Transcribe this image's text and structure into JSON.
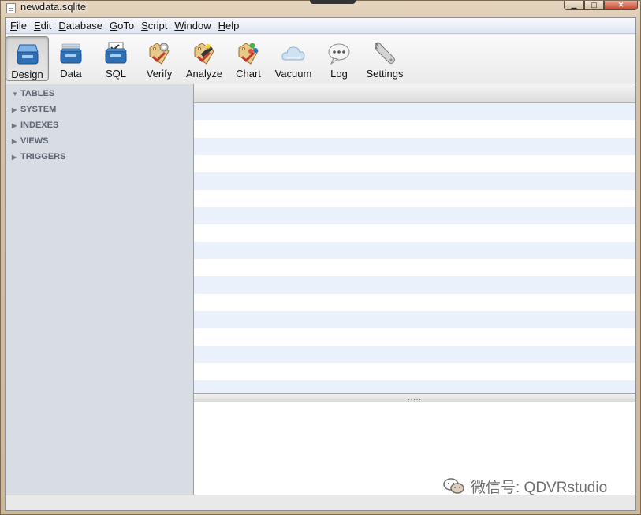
{
  "window": {
    "title": "newdata.sqlite"
  },
  "menu": [
    "File",
    "Edit",
    "Database",
    "GoTo",
    "Script",
    "Window",
    "Help"
  ],
  "toolbar": {
    "buttons": [
      {
        "label": "Design",
        "icon": "design-icon",
        "active": true
      },
      {
        "label": "Data",
        "icon": "data-icon"
      },
      {
        "label": "SQL",
        "icon": "sql-icon"
      },
      {
        "label": "Verify",
        "icon": "verify-icon"
      },
      {
        "label": "Analyze",
        "icon": "analyze-icon"
      },
      {
        "label": "Chart",
        "icon": "chart-icon"
      },
      {
        "label": "Vacuum",
        "icon": "cloud-icon"
      },
      {
        "label": "Log",
        "icon": "speech-bubble-icon"
      },
      {
        "label": "Settings",
        "icon": "wrench-icon"
      }
    ]
  },
  "sidebar": {
    "items": [
      {
        "label": "TABLES",
        "expanded": true
      },
      {
        "label": "SYSTEM",
        "expanded": false
      },
      {
        "label": "INDEXES",
        "expanded": false
      },
      {
        "label": "VIEWS",
        "expanded": false
      },
      {
        "label": "TRIGGERS",
        "expanded": false
      }
    ],
    "bottom": {
      "add": "+",
      "remove": "−",
      "gear": "⚙▾"
    }
  },
  "splitter": {
    "grip": "....."
  },
  "watermark": {
    "text": "微信号: QDVRstudio"
  },
  "colors": {
    "sidebar_bg": "#d8dde4",
    "stripe": "#ebf1fb",
    "accent_blue": "#2f6fb5"
  }
}
